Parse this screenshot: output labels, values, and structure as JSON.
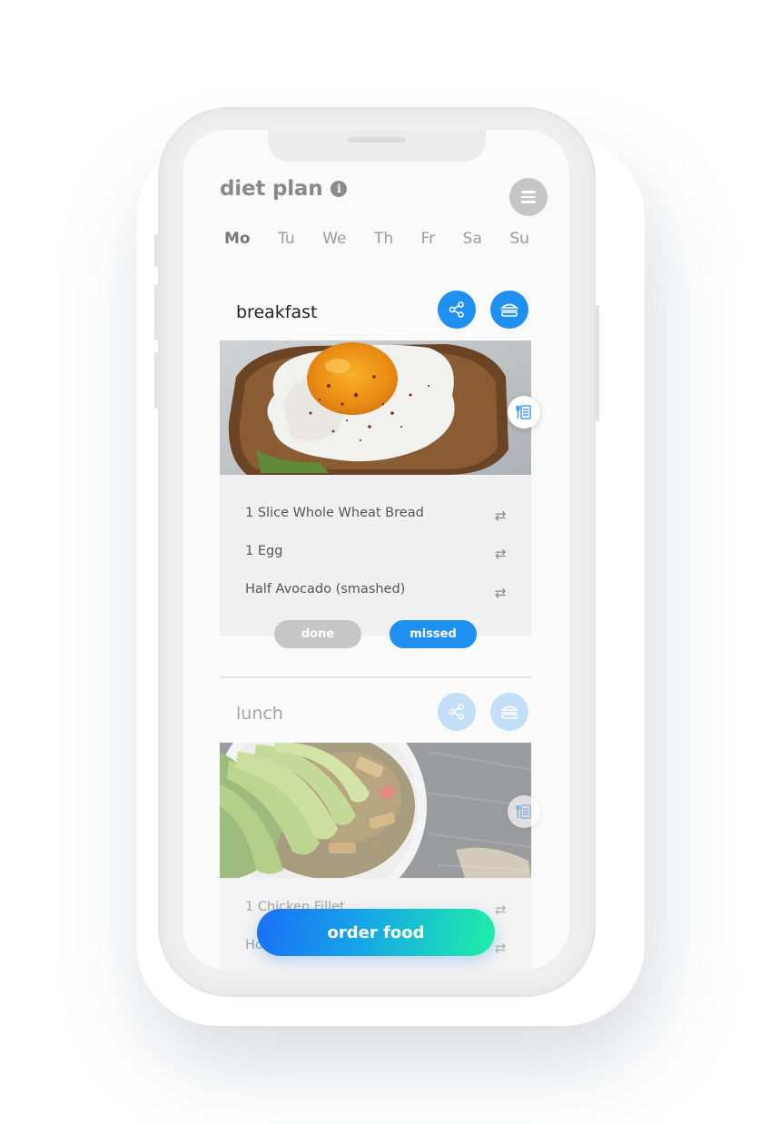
{
  "header": {
    "title": "diet plan",
    "info_icon": "info-icon",
    "menu_icon": "menu-icon"
  },
  "days": [
    {
      "label": "Mo",
      "active": true
    },
    {
      "label": "Tu",
      "active": false
    },
    {
      "label": "We",
      "active": false
    },
    {
      "label": "Th",
      "active": false
    },
    {
      "label": "Fr",
      "active": false
    },
    {
      "label": "Sa",
      "active": false
    },
    {
      "label": "Su",
      "active": false
    }
  ],
  "breakfast": {
    "title": "breakfast",
    "items": [
      "1 Slice Whole Wheat Bread",
      "1 Egg",
      "Half Avocado (smashed)"
    ],
    "done_label": "done",
    "missed_label": "missed"
  },
  "lunch": {
    "title": "lunch",
    "items": [
      "1 Chicken Fillet",
      "Ho"
    ]
  },
  "order_label": "order food",
  "swap_glyph": "⇄",
  "colors": {
    "accent": "#1f8ff0",
    "done": "#c6c6c6",
    "gradient_start": "#1a6ff5",
    "gradient_end": "#1ef0a6"
  }
}
